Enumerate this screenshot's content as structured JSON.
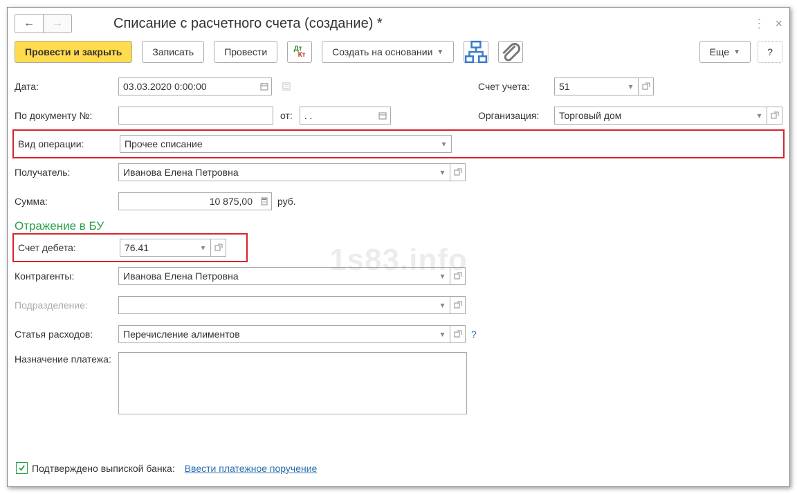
{
  "title": "Списание с расчетного счета (создание) *",
  "toolbar": {
    "post_and_close": "Провести и закрыть",
    "save": "Записать",
    "post": "Провести",
    "create_based": "Создать на основании",
    "more": "Еще"
  },
  "fields": {
    "date_label": "Дата:",
    "date_value": "03.03.2020  0:00:00",
    "docnum_label": "По документу №:",
    "docnum_value": "",
    "from_label": "от:",
    "from_value": "  .  .    ",
    "account_label": "Счет учета:",
    "account_value": "51",
    "org_label": "Организация:",
    "org_value": "Торговый дом",
    "op_type_label": "Вид операции:",
    "op_type_value": "Прочее списание",
    "recipient_label": "Получатель:",
    "recipient_value": "Иванова Елена Петровна",
    "amount_label": "Сумма:",
    "amount_value": "10 875,00",
    "amount_unit": "руб."
  },
  "section_bu": "Отражение в БУ",
  "bu": {
    "debit_acc_label": "Счет дебета:",
    "debit_acc_value": "76.41",
    "contractor_label": "Контрагенты:",
    "contractor_value": "Иванова Елена Петровна",
    "division_label": "Подразделение:",
    "division_value": "",
    "expense_label": "Статья расходов:",
    "expense_value": "Перечисление алиментов",
    "purpose_label": "Назначение платежа:"
  },
  "footer": {
    "confirmed_label": "Подтверждено выпиской банка:",
    "enter_order": "Ввести платежное поручение"
  },
  "watermark": "1s83.info"
}
